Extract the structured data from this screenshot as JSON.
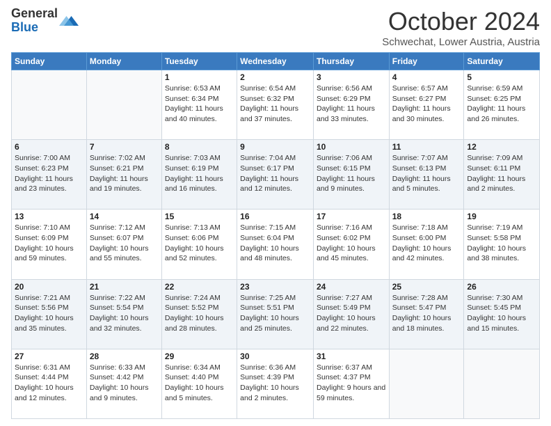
{
  "header": {
    "logo_line1": "General",
    "logo_line2": "Blue",
    "month_title": "October 2024",
    "location": "Schwechat, Lower Austria, Austria"
  },
  "weekdays": [
    "Sunday",
    "Monday",
    "Tuesday",
    "Wednesday",
    "Thursday",
    "Friday",
    "Saturday"
  ],
  "weeks": [
    [
      {
        "day": "",
        "info": ""
      },
      {
        "day": "",
        "info": ""
      },
      {
        "day": "1",
        "info": "Sunrise: 6:53 AM\nSunset: 6:34 PM\nDaylight: 11 hours and 40 minutes."
      },
      {
        "day": "2",
        "info": "Sunrise: 6:54 AM\nSunset: 6:32 PM\nDaylight: 11 hours and 37 minutes."
      },
      {
        "day": "3",
        "info": "Sunrise: 6:56 AM\nSunset: 6:29 PM\nDaylight: 11 hours and 33 minutes."
      },
      {
        "day": "4",
        "info": "Sunrise: 6:57 AM\nSunset: 6:27 PM\nDaylight: 11 hours and 30 minutes."
      },
      {
        "day": "5",
        "info": "Sunrise: 6:59 AM\nSunset: 6:25 PM\nDaylight: 11 hours and 26 minutes."
      }
    ],
    [
      {
        "day": "6",
        "info": "Sunrise: 7:00 AM\nSunset: 6:23 PM\nDaylight: 11 hours and 23 minutes."
      },
      {
        "day": "7",
        "info": "Sunrise: 7:02 AM\nSunset: 6:21 PM\nDaylight: 11 hours and 19 minutes."
      },
      {
        "day": "8",
        "info": "Sunrise: 7:03 AM\nSunset: 6:19 PM\nDaylight: 11 hours and 16 minutes."
      },
      {
        "day": "9",
        "info": "Sunrise: 7:04 AM\nSunset: 6:17 PM\nDaylight: 11 hours and 12 minutes."
      },
      {
        "day": "10",
        "info": "Sunrise: 7:06 AM\nSunset: 6:15 PM\nDaylight: 11 hours and 9 minutes."
      },
      {
        "day": "11",
        "info": "Sunrise: 7:07 AM\nSunset: 6:13 PM\nDaylight: 11 hours and 5 minutes."
      },
      {
        "day": "12",
        "info": "Sunrise: 7:09 AM\nSunset: 6:11 PM\nDaylight: 11 hours and 2 minutes."
      }
    ],
    [
      {
        "day": "13",
        "info": "Sunrise: 7:10 AM\nSunset: 6:09 PM\nDaylight: 10 hours and 59 minutes."
      },
      {
        "day": "14",
        "info": "Sunrise: 7:12 AM\nSunset: 6:07 PM\nDaylight: 10 hours and 55 minutes."
      },
      {
        "day": "15",
        "info": "Sunrise: 7:13 AM\nSunset: 6:06 PM\nDaylight: 10 hours and 52 minutes."
      },
      {
        "day": "16",
        "info": "Sunrise: 7:15 AM\nSunset: 6:04 PM\nDaylight: 10 hours and 48 minutes."
      },
      {
        "day": "17",
        "info": "Sunrise: 7:16 AM\nSunset: 6:02 PM\nDaylight: 10 hours and 45 minutes."
      },
      {
        "day": "18",
        "info": "Sunrise: 7:18 AM\nSunset: 6:00 PM\nDaylight: 10 hours and 42 minutes."
      },
      {
        "day": "19",
        "info": "Sunrise: 7:19 AM\nSunset: 5:58 PM\nDaylight: 10 hours and 38 minutes."
      }
    ],
    [
      {
        "day": "20",
        "info": "Sunrise: 7:21 AM\nSunset: 5:56 PM\nDaylight: 10 hours and 35 minutes."
      },
      {
        "day": "21",
        "info": "Sunrise: 7:22 AM\nSunset: 5:54 PM\nDaylight: 10 hours and 32 minutes."
      },
      {
        "day": "22",
        "info": "Sunrise: 7:24 AM\nSunset: 5:52 PM\nDaylight: 10 hours and 28 minutes."
      },
      {
        "day": "23",
        "info": "Sunrise: 7:25 AM\nSunset: 5:51 PM\nDaylight: 10 hours and 25 minutes."
      },
      {
        "day": "24",
        "info": "Sunrise: 7:27 AM\nSunset: 5:49 PM\nDaylight: 10 hours and 22 minutes."
      },
      {
        "day": "25",
        "info": "Sunrise: 7:28 AM\nSunset: 5:47 PM\nDaylight: 10 hours and 18 minutes."
      },
      {
        "day": "26",
        "info": "Sunrise: 7:30 AM\nSunset: 5:45 PM\nDaylight: 10 hours and 15 minutes."
      }
    ],
    [
      {
        "day": "27",
        "info": "Sunrise: 6:31 AM\nSunset: 4:44 PM\nDaylight: 10 hours and 12 minutes."
      },
      {
        "day": "28",
        "info": "Sunrise: 6:33 AM\nSunset: 4:42 PM\nDaylight: 10 hours and 9 minutes."
      },
      {
        "day": "29",
        "info": "Sunrise: 6:34 AM\nSunset: 4:40 PM\nDaylight: 10 hours and 5 minutes."
      },
      {
        "day": "30",
        "info": "Sunrise: 6:36 AM\nSunset: 4:39 PM\nDaylight: 10 hours and 2 minutes."
      },
      {
        "day": "31",
        "info": "Sunrise: 6:37 AM\nSunset: 4:37 PM\nDaylight: 9 hours and 59 minutes."
      },
      {
        "day": "",
        "info": ""
      },
      {
        "day": "",
        "info": ""
      }
    ]
  ]
}
